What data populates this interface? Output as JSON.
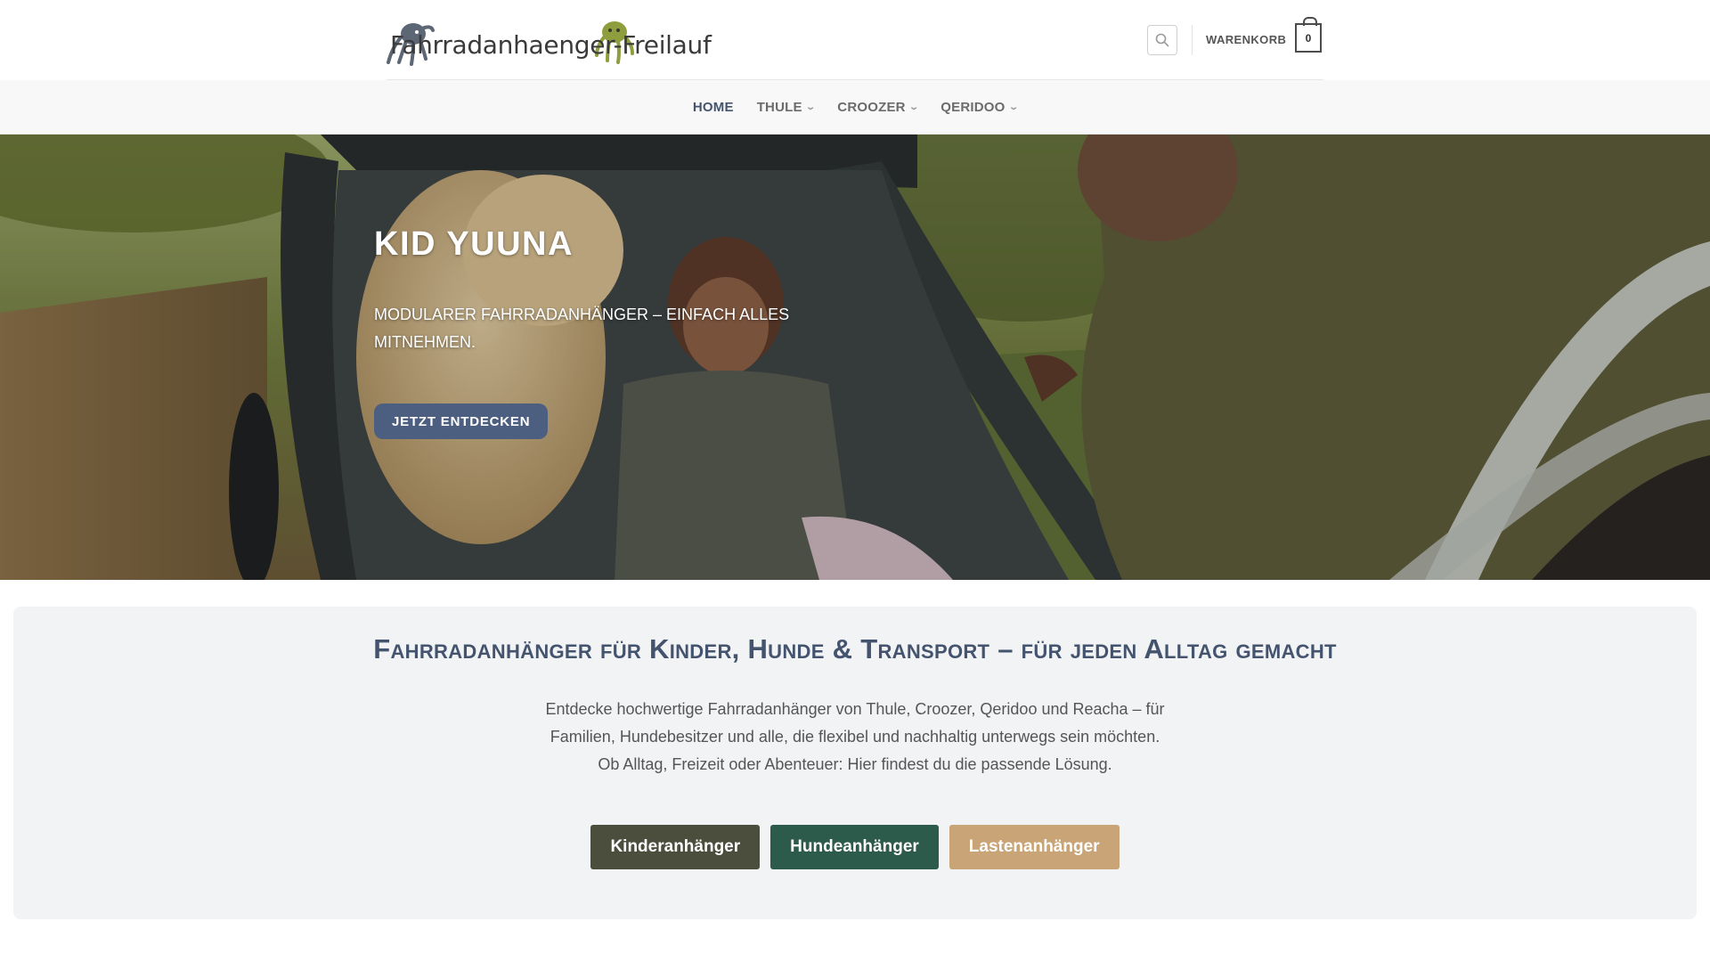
{
  "header": {
    "logo_text": "Fahrradanhaenger-Freilauf",
    "cart_label": "WARENKORB",
    "cart_count": "0"
  },
  "nav": {
    "items": [
      {
        "label": "HOME",
        "active": true
      },
      {
        "label": "THULE",
        "has_dropdown": true
      },
      {
        "label": "CROOZER",
        "has_dropdown": true
      },
      {
        "label": "QERIDOO",
        "has_dropdown": true
      }
    ]
  },
  "hero": {
    "title": "KID YUUNA",
    "subtitle": "MODULARER FAHRRADANHÄNGER – EINFACH ALLES MITNEHMEN.",
    "button_label": "JETZT ENTDECKEN"
  },
  "intro": {
    "title": "Fahrradanhänger für Kinder, Hunde & Transport – für jeden Alltag gemacht",
    "text_line1": "Entdecke hochwertige Fahrradanhänger von Thule, Croozer, Qeridoo und Reacha – für Familien, Hundebesitzer und alle, die flexibel und nachhaltig unterwegs sein möchten.",
    "text_line2": "Ob Alltag, Freizeit oder Abenteuer: Hier findest du die passende Lösung.",
    "buttons": {
      "kinder": "Kinderanhänger",
      "hunde": "Hundeanhänger",
      "lasten": "Lastenanhänger"
    }
  },
  "colors": {
    "accent": "#44546f",
    "hero_button": "#4d5f80",
    "kinder_button": "#4b4e3d",
    "hunde_button": "#2c5a4b",
    "lasten_button": "#c9a476"
  },
  "icons": {
    "search": "search-icon",
    "cart": "cart-bag-icon",
    "dropdown": "chevron-down-icon"
  }
}
